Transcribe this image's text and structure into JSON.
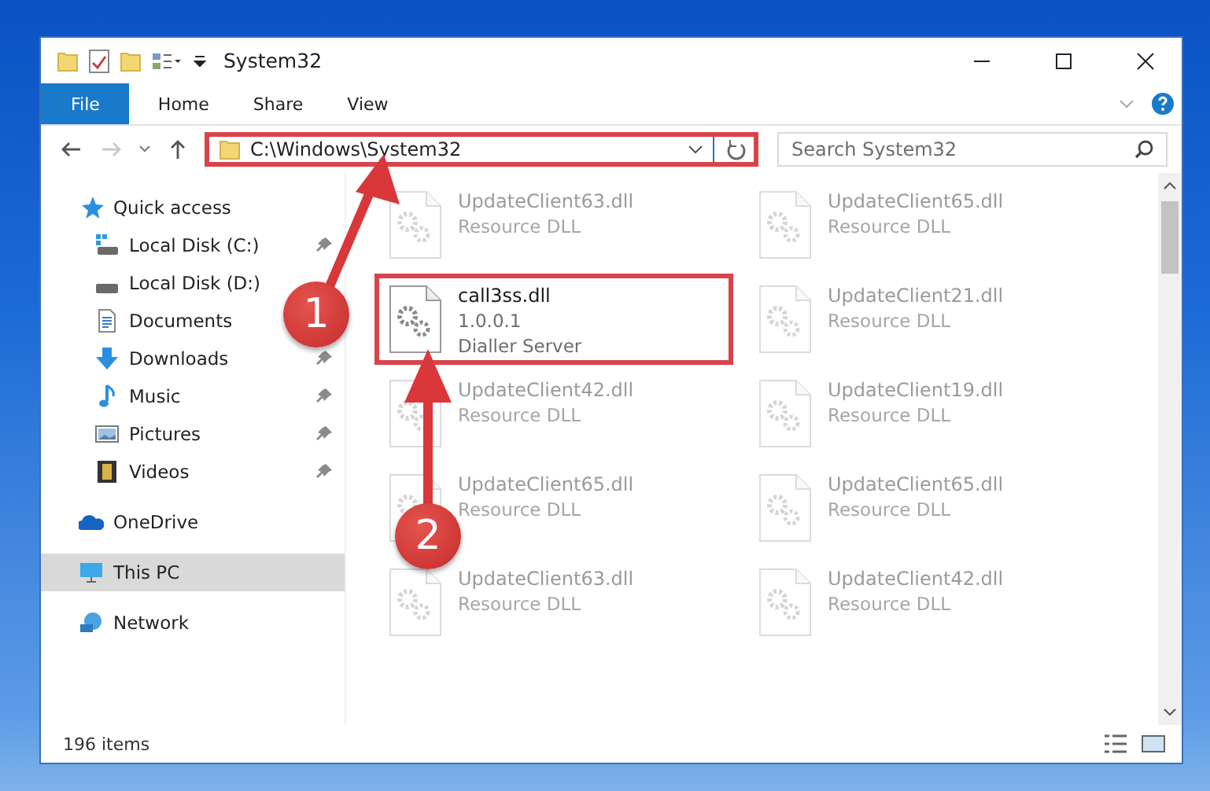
{
  "window": {
    "title": "System32"
  },
  "ribbon_tabs": [
    {
      "label": "File",
      "kind": "file"
    },
    {
      "label": "Home",
      "kind": "tab"
    },
    {
      "label": "Share",
      "kind": "tab"
    },
    {
      "label": "View",
      "kind": "tab"
    }
  ],
  "address": {
    "path": "C:\\Windows\\System32",
    "highlighted": true
  },
  "search": {
    "placeholder": "Search System32"
  },
  "sidebar": [
    {
      "label": "Quick access",
      "selected": false,
      "children": [
        {
          "label": "Local Disk (C:)",
          "pinned": true,
          "selected": false
        },
        {
          "label": "Local Disk (D:)",
          "selected": false
        },
        {
          "label": "Documents",
          "selected": false
        },
        {
          "label": "Downloads",
          "pinned": true,
          "selected": false
        },
        {
          "label": "Music",
          "pinned": true,
          "selected": false
        },
        {
          "label": "Pictures",
          "pinned": true,
          "selected": false
        },
        {
          "label": "Videos",
          "pinned": true,
          "selected": false
        }
      ]
    },
    {
      "label": "OneDrive",
      "selected": false
    },
    {
      "label": "This PC",
      "selected": true
    },
    {
      "label": "Network",
      "selected": false
    }
  ],
  "files": [
    {
      "name": "UpdateClient63.dll",
      "lines": [
        "Resource DLL"
      ],
      "highlighted": false
    },
    {
      "name": "UpdateClient65.dll",
      "lines": [
        "Resource DLL"
      ],
      "highlighted": false
    },
    {
      "name": "call3ss.dll",
      "lines": [
        "1.0.0.1",
        "Dialler Server"
      ],
      "highlighted": true
    },
    {
      "name": "UpdateClient21.dll",
      "lines": [
        "Resource DLL"
      ],
      "highlighted": false
    },
    {
      "name": "UpdateClient42.dll",
      "lines": [
        "Resource DLL"
      ],
      "highlighted": false
    },
    {
      "name": "UpdateClient19.dll",
      "lines": [
        "Resource DLL"
      ],
      "highlighted": false
    },
    {
      "name": "UpdateClient65.dll",
      "lines": [
        "Resource DLL"
      ],
      "highlighted": false
    },
    {
      "name": "UpdateClient65.dll",
      "lines": [
        "Resource DLL"
      ],
      "highlighted": false
    },
    {
      "name": "UpdateClient63.dll",
      "lines": [
        "Resource DLL"
      ],
      "highlighted": false
    },
    {
      "name": "UpdateClient42.dll",
      "lines": [
        "Resource DLL"
      ],
      "highlighted": false
    }
  ],
  "status_bar": {
    "count": "196 items"
  },
  "steps": [
    {
      "number": "1"
    },
    {
      "number": "2"
    }
  ]
}
